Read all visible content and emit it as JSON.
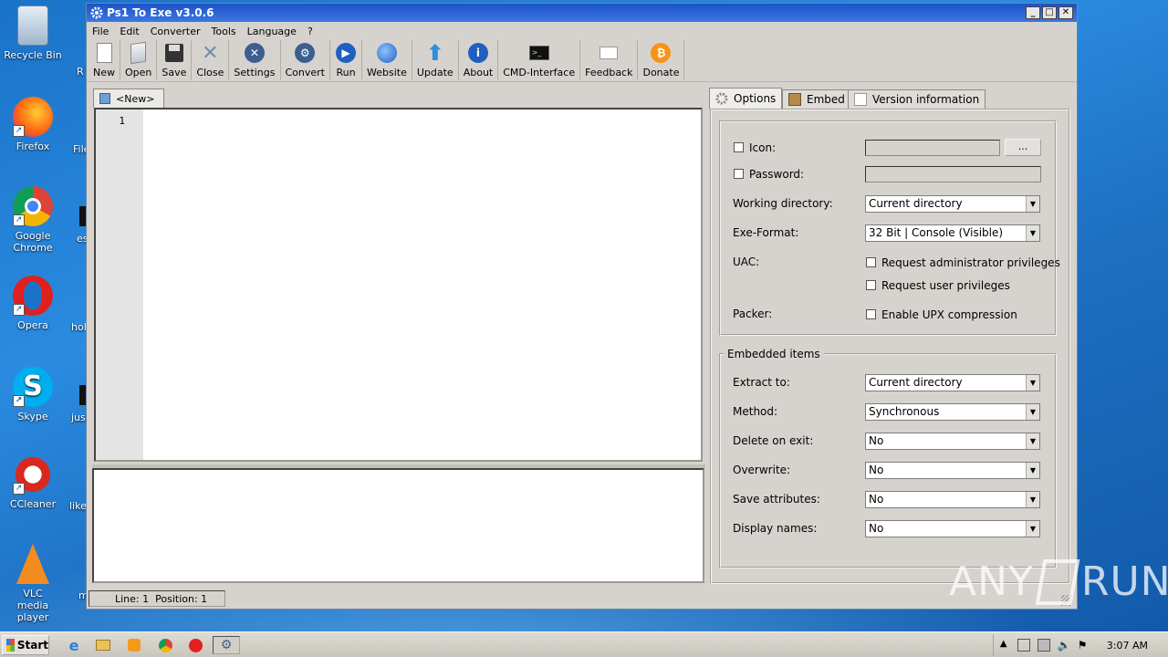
{
  "desktop": {
    "icons": [
      {
        "label": "Recycle Bin"
      },
      {
        "label": "Firefox"
      },
      {
        "label": "Google Chrome"
      },
      {
        "label": "Opera"
      },
      {
        "label": "Skype"
      },
      {
        "label": "CCleaner"
      },
      {
        "label": "VLC media player"
      }
    ],
    "partial_labels": [
      "R",
      "File",
      "es",
      "hol",
      "just",
      "like",
      "m"
    ]
  },
  "window": {
    "title": "Ps1 To Exe v3.0.6",
    "buttons": {
      "minimize": "_",
      "maximize": "□",
      "close": "✕"
    }
  },
  "menu": [
    "File",
    "Edit",
    "Converter",
    "Tools",
    "Language",
    "?"
  ],
  "toolbar": [
    "New",
    "Open",
    "Save",
    "Close",
    "Settings",
    "Convert",
    "Run",
    "Website",
    "Update",
    "About",
    "CMD-Interface",
    "Feedback",
    "Donate"
  ],
  "editor": {
    "tab_label": "<New>",
    "line_number": "1"
  },
  "status": {
    "text": "Line: 1  Position: 1"
  },
  "right_tabs": [
    "Options",
    "Embed",
    "Version information"
  ],
  "options": {
    "icon_label": "Icon:",
    "icon_browse": "...",
    "password_label": "Password:",
    "working_dir_label": "Working directory:",
    "working_dir_value": "Current directory",
    "exe_format_label": "Exe-Format:",
    "exe_format_value": "32 Bit | Console (Visible)",
    "uac_label": "UAC:",
    "uac_admin": "Request administrator privileges",
    "uac_user": "Request user privileges",
    "packer_label": "Packer:",
    "packer_upx": "Enable UPX compression"
  },
  "embedded": {
    "legend": "Embedded items",
    "extract_label": "Extract to:",
    "extract_value": "Current directory",
    "method_label": "Method:",
    "method_value": "Synchronous",
    "delete_label": "Delete on exit:",
    "delete_value": "No",
    "overwrite_label": "Overwrite:",
    "overwrite_value": "No",
    "save_attr_label": "Save attributes:",
    "save_attr_value": "No",
    "display_names_label": "Display names:",
    "display_names_value": "No"
  },
  "watermark": {
    "left": "ANY",
    "right": "RUN"
  },
  "taskbar": {
    "start_label": "Start",
    "clock": "3:07 AM"
  }
}
